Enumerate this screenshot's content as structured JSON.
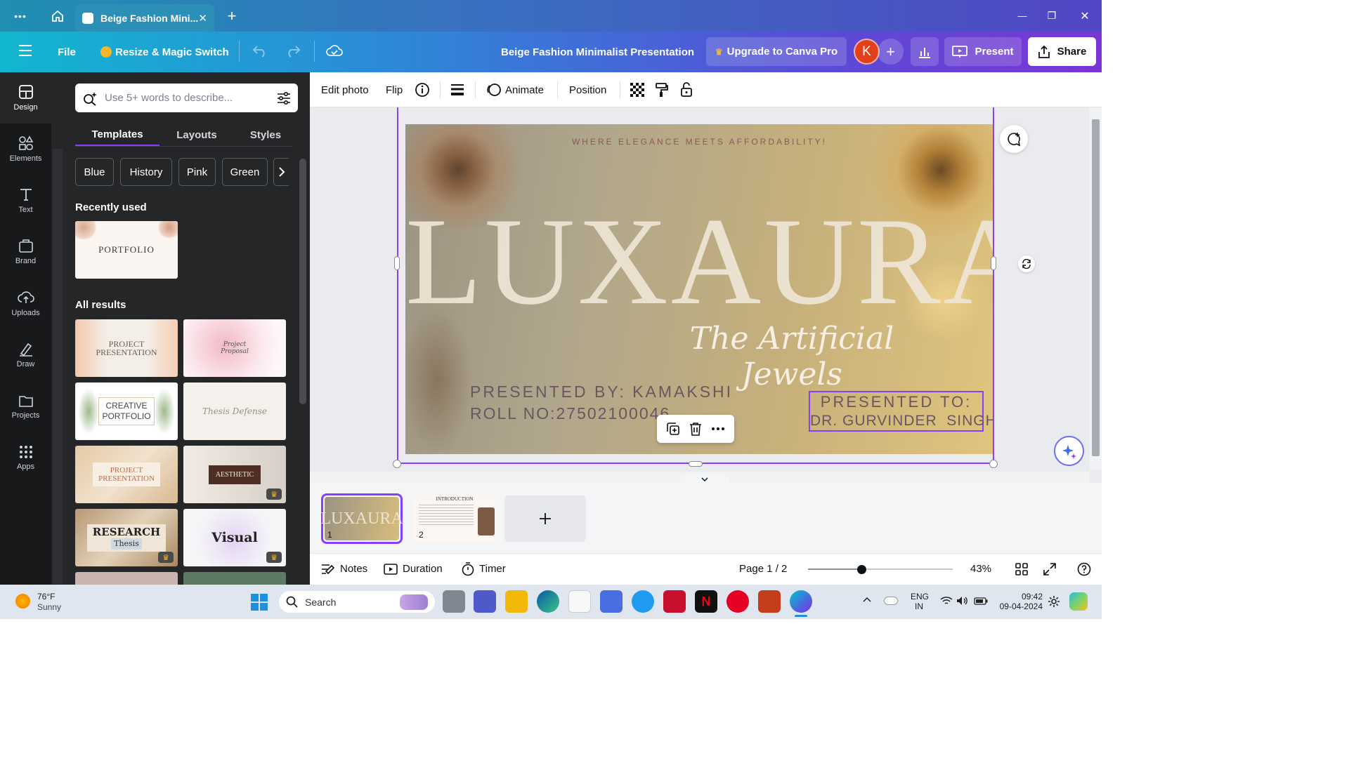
{
  "window": {
    "tab_title": "Beige Fashion Mini...",
    "tab_close": "✕",
    "new_tab": "+",
    "menu_dots": "•••",
    "controls": {
      "minimize": "—",
      "maximize": "❐",
      "close": "✕"
    }
  },
  "header": {
    "file": "File",
    "resize": "Resize & Magic Switch",
    "doc_title": "Beige Fashion Minimalist Presentation",
    "upgrade": "Upgrade to Canva Pro",
    "avatar_initial": "K",
    "present": "Present",
    "share": "Share"
  },
  "rail": [
    {
      "label": "Design",
      "icon": "design-icon"
    },
    {
      "label": "Elements",
      "icon": "elements-icon"
    },
    {
      "label": "Text",
      "icon": "text-icon"
    },
    {
      "label": "Brand",
      "icon": "brand-icon"
    },
    {
      "label": "Uploads",
      "icon": "uploads-icon"
    },
    {
      "label": "Draw",
      "icon": "draw-icon"
    },
    {
      "label": "Projects",
      "icon": "projects-icon"
    },
    {
      "label": "Apps",
      "icon": "apps-icon"
    }
  ],
  "panel": {
    "search_placeholder": "Use 5+ words to describe...",
    "tabs": [
      "Templates",
      "Layouts",
      "Styles"
    ],
    "chips": [
      "Blue",
      "History",
      "Pink",
      "Green"
    ],
    "recently_used": "Recently used",
    "recent_thumb": "PORTFOLIO",
    "all_results": "All results",
    "results": [
      {
        "title": "PROJECT PRESENTATION"
      },
      {
        "title": "Project Proposal"
      },
      {
        "title": "CREATIVE PORTFOLIO"
      },
      {
        "title": "Thesis Defense"
      },
      {
        "title": "PROJECT PRESENTATION"
      },
      {
        "title": "AESTHETIC"
      },
      {
        "title": "RESEARCH",
        "subtitle": "Thesis"
      },
      {
        "title": "Visual"
      }
    ]
  },
  "toolbar": {
    "edit_photo": "Edit photo",
    "flip": "Flip",
    "animate": "Animate",
    "position": "Position"
  },
  "slide": {
    "tagline": "WHERE ELEGANCE MEETS AFFORDABILITY!",
    "brand": "LUXAURA",
    "script": "The Artificial Jewels",
    "presented_by": "PRESENTED BY: KAMAKSHI",
    "roll_no": "ROLL NO:27502100046",
    "presented_to_label": "PRESENTED TO:",
    "presented_to_name": "DR. GURVINDER  SINGH"
  },
  "pages": [
    {
      "num": "1",
      "label": "LUXAURA"
    },
    {
      "num": "2",
      "label": "INTRODUCTION"
    }
  ],
  "footer": {
    "notes": "Notes",
    "duration": "Duration",
    "timer": "Timer",
    "page_indicator": "Page 1 / 2",
    "zoom": "43%",
    "zoom_fraction": 0.37
  },
  "taskbar": {
    "temp": "76°F",
    "weather": "Sunny",
    "search": "Search",
    "lang_1": "ENG",
    "lang_2": "IN",
    "time": "09:42",
    "date": "09-04-2024"
  },
  "colors": {
    "accent_purple": "#8b3dff",
    "avatar_bg": "#e2401b",
    "crown_gold": "#f5b829"
  }
}
